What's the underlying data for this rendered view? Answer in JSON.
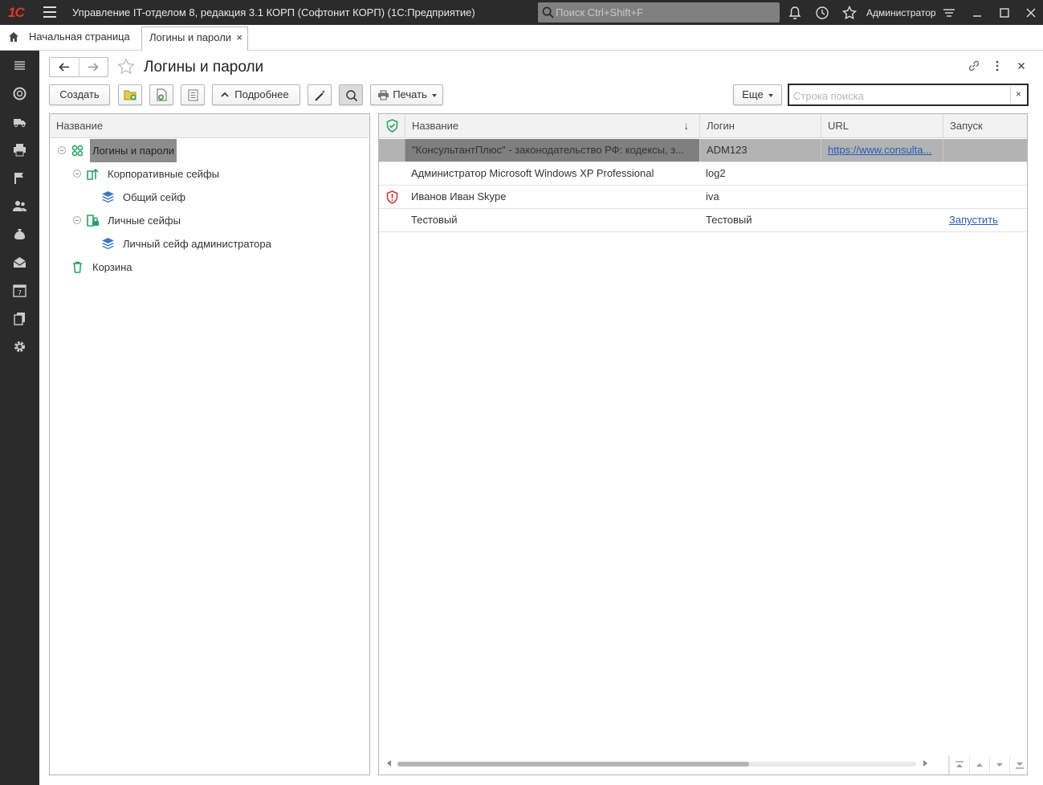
{
  "titlebar": {
    "logo": "1С",
    "app_title": "Управление IT-отделом 8, редакция 3.1 КОРП (Софтонит КОРП)  (1С:Предприятие)",
    "search_placeholder": "Поиск Ctrl+Shift+F",
    "user": "Администратор"
  },
  "tabs": {
    "home": "Начальная страница",
    "active": "Логины и пароли",
    "close": "×"
  },
  "page": {
    "title": "Логины и пароли"
  },
  "toolbar": {
    "create": "Создать",
    "more_details": "Подробнее",
    "print": "Печать",
    "more": "Еще",
    "search_placeholder": "Строка поиска",
    "search_clear": "×"
  },
  "tree": {
    "header": "Название",
    "items": [
      {
        "label": "Логины и пароли"
      },
      {
        "label": "Корпоративные сейфы"
      },
      {
        "label": "Общий сейф"
      },
      {
        "label": "Личные сейфы"
      },
      {
        "label": "Личный сейф администратора"
      },
      {
        "label": "Корзина"
      }
    ]
  },
  "grid": {
    "columns": {
      "name": "Название",
      "login": "Логин",
      "url": "URL",
      "launch": "Запуск"
    },
    "sort_indicator": "↓",
    "rows": [
      {
        "name": "\"КонсультантПлюс\" - законодательство РФ: кодексы, з...",
        "login": "ADM123",
        "url": "https://www.consulta...",
        "launch": ""
      },
      {
        "name": "Администратор Microsoft Windows XP Professional",
        "login": "log2",
        "url": "",
        "launch": ""
      },
      {
        "name": "Иванов Иван Skype",
        "login": "iva",
        "url": "",
        "launch": ""
      },
      {
        "name": "Тестовый",
        "login": "Тестовый",
        "url": "",
        "launch": "Запустить"
      }
    ]
  },
  "colors": {
    "titlebar_bg": "#2b2b2b",
    "sidebar_bg": "#2b2b2b",
    "accent_green": "#2aa46a",
    "accent_red": "#d9333b",
    "link": "#2a5ab7",
    "selection_row": "#b3b3b3",
    "selection_cell": "#7f7f7f"
  }
}
